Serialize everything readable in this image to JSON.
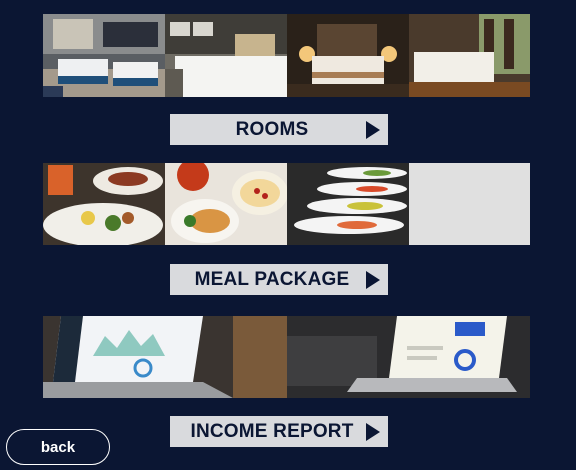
{
  "rooms_section": {
    "images": [
      {
        "icon": "hotel-room-twin-beds-photo"
      },
      {
        "icon": "hotel-room-white-bed-photo"
      },
      {
        "icon": "hotel-room-lamp-bed-photo"
      },
      {
        "icon": "hotel-room-wood-floor-photo"
      }
    ],
    "button_label": "ROOMS"
  },
  "meal_section": {
    "images": [
      {
        "icon": "breakfast-plates-photo"
      },
      {
        "icon": "rice-and-chicken-photo"
      },
      {
        "icon": "buffet-spoons-photo"
      }
    ],
    "button_label": "MEAL PACKAGE"
  },
  "income_section": {
    "images": [
      {
        "icon": "laptop-dashboard-photo"
      },
      {
        "icon": "laptop-charts-photo"
      }
    ],
    "button_label": "INCOME REPORT"
  },
  "back_button": {
    "label": "back"
  },
  "colors": {
    "background": "#0b1633",
    "button_bg": "#d9dadd",
    "button_text": "#0b1633"
  }
}
